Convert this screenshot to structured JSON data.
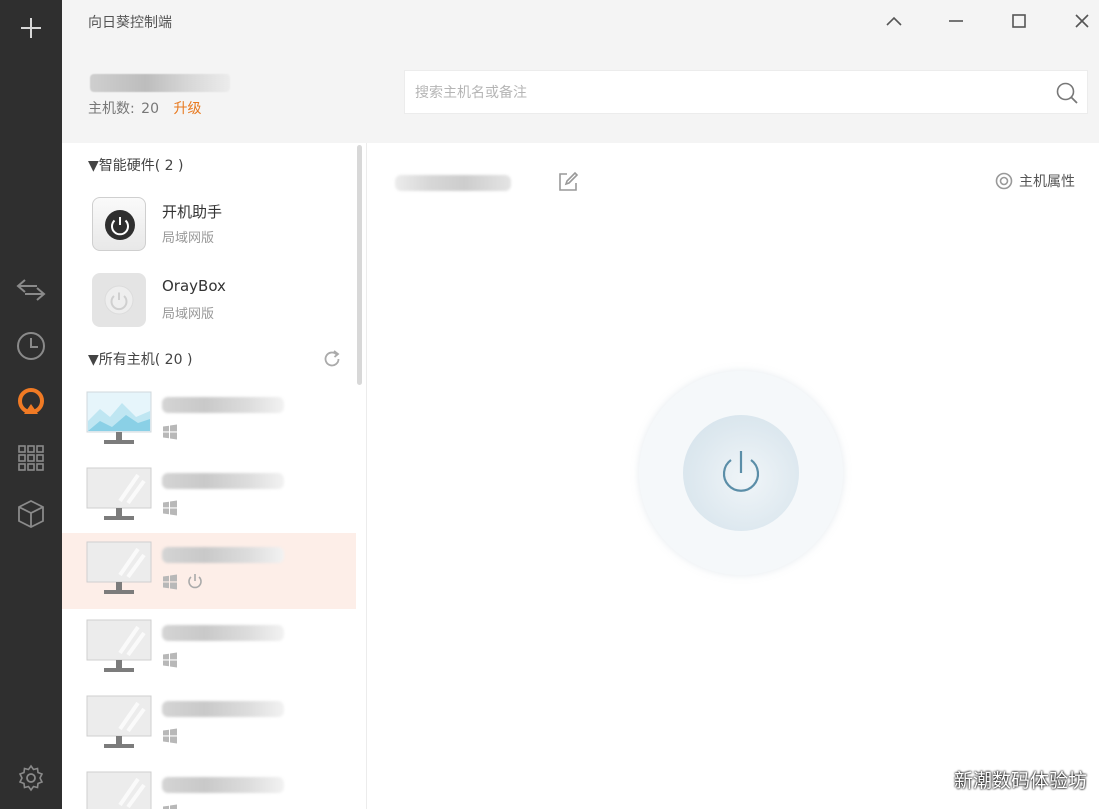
{
  "window": {
    "title": "向日葵控制端"
  },
  "account": {
    "host_count_label": "主机数:",
    "host_count": "20",
    "upgrade_label": "升级"
  },
  "search": {
    "placeholder": "搜索主机名或备注"
  },
  "groups": {
    "hardware": {
      "label": "▼智能硬件( 2 )"
    },
    "all_hosts": {
      "label": "▼所有主机( 20 )"
    }
  },
  "hardware_items": [
    {
      "name": "开机助手",
      "subtitle": "局域网版",
      "icon": "power-button-icon"
    },
    {
      "name": "OrayBox",
      "subtitle": "局域网版",
      "icon": "power-button-icon"
    }
  ],
  "hosts": [
    {
      "os": "windows-icon",
      "online": true,
      "selected": false
    },
    {
      "os": "windows-icon",
      "online": false,
      "selected": false
    },
    {
      "os": "windows-icon",
      "online": false,
      "selected": true
    },
    {
      "os": "windows-icon",
      "online": false,
      "selected": false
    },
    {
      "os": "windows-icon",
      "online": false,
      "selected": false
    },
    {
      "os": "windows-icon",
      "online": false,
      "selected": false
    }
  ],
  "detail": {
    "properties_label": "主机属性"
  },
  "watermark": "新潮数码体验坊",
  "colors": {
    "rail": "#2f2f2f",
    "accent": "#e8791e",
    "selected_row": "#fdeee8",
    "header_bg": "#f4f4f4"
  }
}
